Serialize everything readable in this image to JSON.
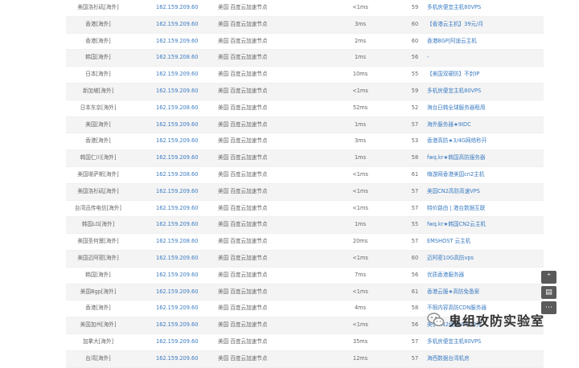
{
  "rows": [
    {
      "location": "美国洛杉矶[海外]",
      "ip": "162.159.209.60",
      "isp": "美国 百度云加速节点",
      "latency": "<1ms",
      "ttl": "59",
      "sponsor": "多机房便宜主机80VPS"
    },
    {
      "location": "香港[海外]",
      "ip": "162.159.209.60",
      "isp": "美国 百度云加速节点",
      "latency": "3ms",
      "ttl": "60",
      "sponsor": "【香港云主机】39元/月"
    },
    {
      "location": "香港[海外]",
      "ip": "162.159.209.60",
      "isp": "美国 百度云加速节点",
      "latency": "2ms",
      "ttl": "60",
      "sponsor": "香港BGP|阿迪云主机"
    },
    {
      "location": "韩国[海外]",
      "ip": "162.159.208.60",
      "isp": "美国 百度云加速节点",
      "latency": "1ms",
      "ttl": "56",
      "sponsor": "-"
    },
    {
      "location": "日本[海外]",
      "ip": "162.159.209.60",
      "isp": "美国 百度云加速节点",
      "latency": "10ms",
      "ttl": "55",
      "sponsor": "【美国双硬防】不封IP"
    },
    {
      "location": "新加坡[海外]",
      "ip": "162.159.209.60",
      "isp": "美国 百度云加速节点",
      "latency": "<1ms",
      "ttl": "59",
      "sponsor": "多机房便宜主机80VPS"
    },
    {
      "location": "日本东京[海外]",
      "ip": "162.159.208.60",
      "isp": "美国 百度云加速节点",
      "latency": "52ms",
      "ttl": "52",
      "sponsor": "海台日韩全球服务器租用"
    },
    {
      "location": "美国[海外]",
      "ip": "162.159.209.60",
      "isp": "美国 百度云加速节点",
      "latency": "1ms",
      "ttl": "57",
      "sponsor": "海外服务器★9IDC"
    },
    {
      "location": "香港[海外]",
      "ip": "162.159.209.60",
      "isp": "美国 百度云加速节点",
      "latency": "3ms",
      "ttl": "53",
      "sponsor": "香港高防★3/4G网络秒开"
    },
    {
      "location": "韩国仁川[海外]",
      "ip": "162.159.209.60",
      "isp": "美国 百度云加速节点",
      "latency": "1ms",
      "ttl": "58",
      "sponsor": "fwq.kr★韩国高防服务器"
    },
    {
      "location": "美国堪萨斯[海外]",
      "ip": "162.159.208.60",
      "isp": "美国 百度云加速节点",
      "latency": "<1ms",
      "ttl": "61",
      "sponsor": "嗨游网香港美国cn2主机"
    },
    {
      "location": "美国洛杉矶[海外]",
      "ip": "162.159.209.60",
      "isp": "美国 百度云加速节点",
      "latency": "<1ms",
      "ttl": "57",
      "sponsor": "美国CN2高防高速VPS"
    },
    {
      "location": "台湾迅传电信[海外]",
      "ip": "162.159.209.60",
      "isp": "美国 百度云加速节点",
      "latency": "<1ms",
      "ttl": "57",
      "sponsor": "特价路由 | 港台数据互联"
    },
    {
      "location": "韩国LG[海外]",
      "ip": "162.159.209.60",
      "isp": "美国 百度云加速节点",
      "latency": "1ms",
      "ttl": "55",
      "sponsor": "fwq.kr★韩国CN2云主机"
    },
    {
      "location": "美国圣何塞[海外]",
      "ip": "162.159.208.60",
      "isp": "美国 百度云加速节点",
      "latency": "20ms",
      "ttl": "57",
      "sponsor": "EMSHOST 云主机"
    },
    {
      "location": "美国迈阿密[海外]",
      "ip": "162.159.209.60",
      "isp": "美国 百度云加速节点",
      "latency": "<1ms",
      "ttl": "60",
      "sponsor": "迈阿密10G高防vps"
    },
    {
      "location": "韩国[海外]",
      "ip": "162.159.209.60",
      "isp": "美国 百度云加速节点",
      "latency": "7ms",
      "ttl": "56",
      "sponsor": "优质香港服务器"
    },
    {
      "location": "美国Bgp[海外]",
      "ip": "162.159.209.60",
      "isp": "美国 百度云加速节点",
      "latency": "<1ms",
      "ttl": "61",
      "sponsor": "香港云服★高防免备案"
    },
    {
      "location": "香港[海外]",
      "ip": "162.159.209.60",
      "isp": "美国 百度云加速节点",
      "latency": "4ms",
      "ttl": "58",
      "sponsor": "不限内容高防CDN服务器"
    },
    {
      "location": "美国加州[海外]",
      "ip": "162.159.209.60",
      "isp": "美国 百度云加速节点",
      "latency": "<1ms",
      "ttl": "56",
      "sponsor": "美伊CN2线路VPS29元"
    },
    {
      "location": "加拿大[海外]",
      "ip": "162.159.209.60",
      "isp": "美国 百度云加速节点",
      "latency": "35ms",
      "ttl": "57",
      "sponsor": "多机房便宜主机80VPS"
    },
    {
      "location": "台湾[海外]",
      "ip": "162.159.209.60",
      "isp": "美国 百度云加速节点",
      "latency": "12ms",
      "ttl": "57",
      "sponsor": "海西数据台湾机房"
    }
  ],
  "side_tools": [
    {
      "icon": "chevron-up-icon",
      "glyph": "⌃"
    },
    {
      "icon": "feedback-icon",
      "glyph": "▤"
    },
    {
      "icon": "more-icon",
      "glyph": "⋯"
    }
  ],
  "watermark": {
    "text": "鬼组攻防实验室"
  }
}
